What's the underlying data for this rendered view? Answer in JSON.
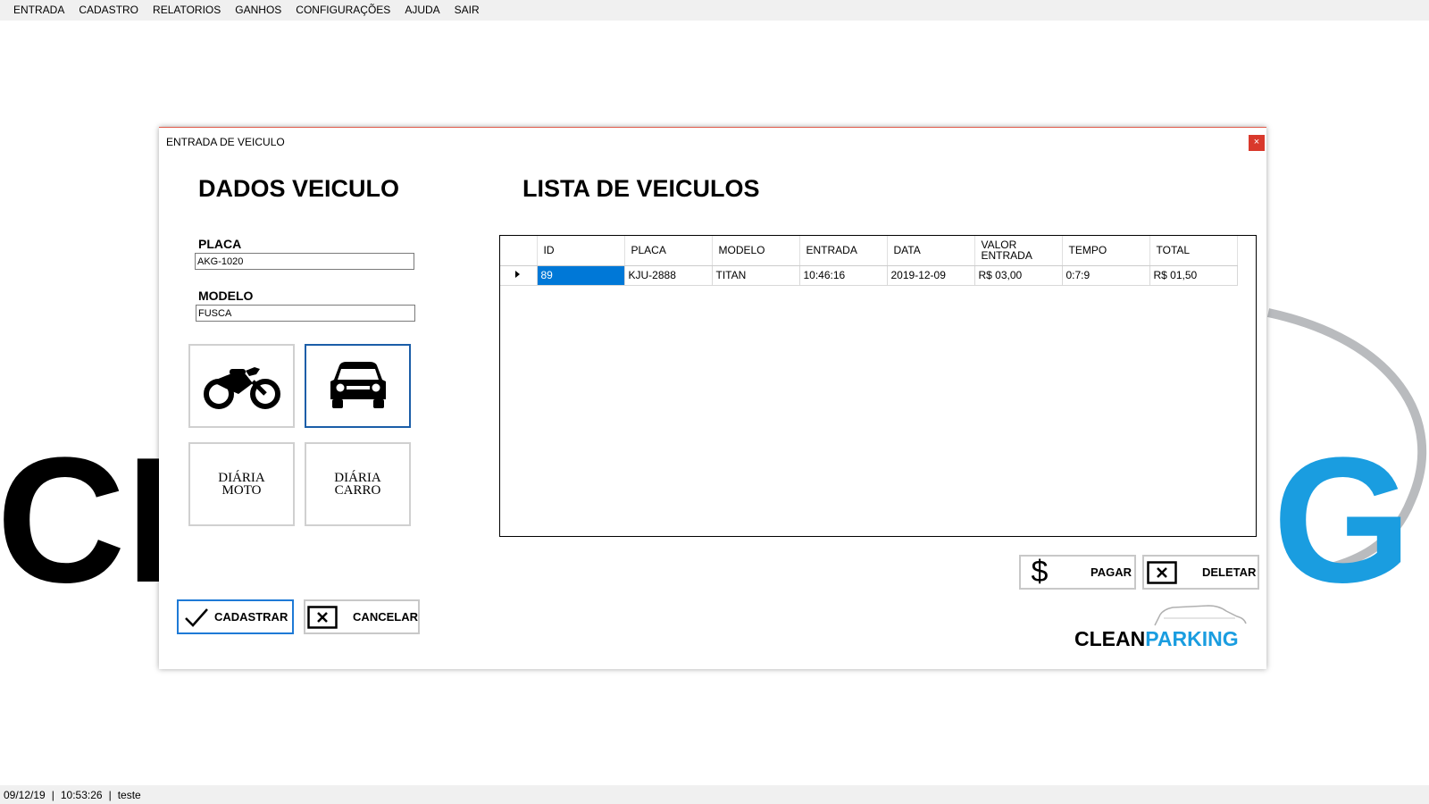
{
  "menu": {
    "items": [
      "ENTRADA",
      "CADASTRO",
      "RELATORIOS",
      "GANHOS",
      "CONFIGURAÇÕES",
      "AJUDA",
      "SAIR"
    ]
  },
  "background_logo": {
    "left_text": "CL",
    "right_text": "G",
    "left_color": "#000000",
    "right_color": "#1a9de0"
  },
  "dialog": {
    "title": "ENTRADA DE VEICULO",
    "close_label": "×",
    "dados_heading": "DADOS VEICULO",
    "lista_heading": "LISTA DE VEICULOS",
    "placa_label": "PLACA",
    "placa_value": "AKG-1020",
    "modelo_label": "MODELO",
    "modelo_value": "FUSCA",
    "moto_icon": "motorcycle-icon",
    "carro_icon": "car-icon",
    "diaria_moto_line1": "DIÁRIA",
    "diaria_moto_line2": "MOTO",
    "diaria_carro_line1": "DIÁRIA",
    "diaria_carro_line2": "CARRO",
    "cadastrar_label": "CADASTRAR",
    "cancelar_label": "CANCELAR",
    "pagar_label": "PAGAR",
    "deletar_label": "DELETAR",
    "pagar_icon": "$",
    "logo_clean": "CLEAN",
    "logo_parking": "PARKING",
    "logo_clean_color": "#000000",
    "logo_parking_color": "#1a9de0"
  },
  "grid": {
    "columns": [
      "ID",
      "PLACA",
      "MODELO",
      "ENTRADA",
      "DATA",
      "VALOR ENTRADA",
      "TEMPO",
      "TOTAL"
    ],
    "rows": [
      [
        "89",
        "KJU-2888",
        "TITAN",
        "10:46:16",
        "2019-12-09",
        "R$ 03,00",
        "0:7:9",
        "R$ 01,50"
      ]
    ]
  },
  "status": {
    "date": "09/12/19",
    "time": "10:53:26",
    "user": "teste"
  }
}
